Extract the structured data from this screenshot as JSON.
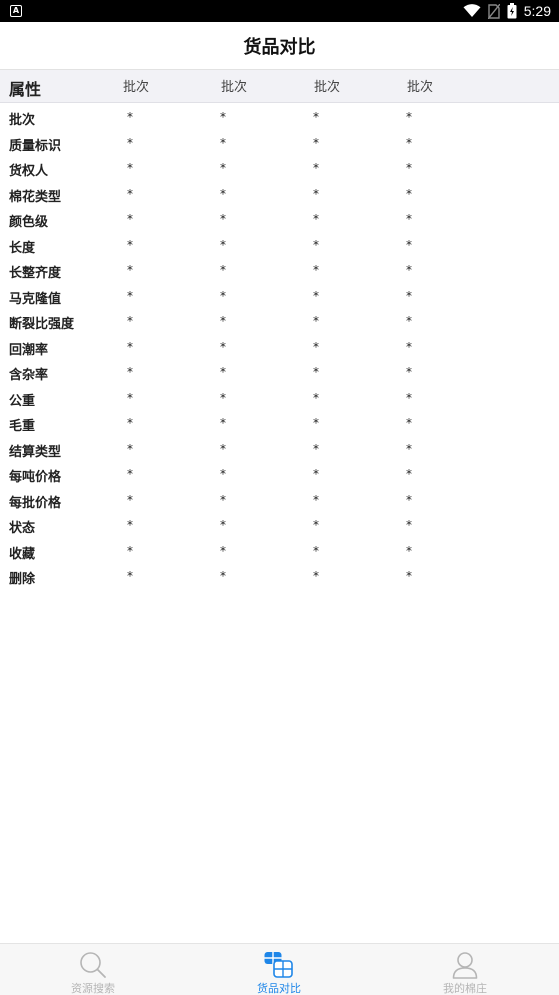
{
  "status_bar": {
    "notification_icon": "A",
    "time": "5:29"
  },
  "title": "货品对比",
  "header": {
    "attribute_label": "属性",
    "columns": [
      "批次",
      "批次",
      "批次",
      "批次"
    ]
  },
  "rows": [
    {
      "label": "批次",
      "values": [
        "*",
        "*",
        "*",
        "*"
      ]
    },
    {
      "label": "质量标识",
      "values": [
        "*",
        "*",
        "*",
        "*"
      ]
    },
    {
      "label": "货权人",
      "values": [
        "*",
        "*",
        "*",
        "*"
      ]
    },
    {
      "label": "棉花类型",
      "values": [
        "*",
        "*",
        "*",
        "*"
      ]
    },
    {
      "label": "颜色级",
      "values": [
        "*",
        "*",
        "*",
        "*"
      ]
    },
    {
      "label": "长度",
      "values": [
        "*",
        "*",
        "*",
        "*"
      ]
    },
    {
      "label": "长整齐度",
      "values": [
        "*",
        "*",
        "*",
        "*"
      ]
    },
    {
      "label": "马克隆值",
      "values": [
        "*",
        "*",
        "*",
        "*"
      ]
    },
    {
      "label": "断裂比强度",
      "values": [
        "*",
        "*",
        "*",
        "*"
      ]
    },
    {
      "label": "回潮率",
      "values": [
        "*",
        "*",
        "*",
        "*"
      ]
    },
    {
      "label": "含杂率",
      "values": [
        "*",
        "*",
        "*",
        "*"
      ]
    },
    {
      "label": "公重",
      "values": [
        "*",
        "*",
        "*",
        "*"
      ]
    },
    {
      "label": "毛重",
      "values": [
        "*",
        "*",
        "*",
        "*"
      ]
    },
    {
      "label": "结算类型",
      "values": [
        "*",
        "*",
        "*",
        "*"
      ]
    },
    {
      "label": "每吨价格",
      "values": [
        "*",
        "*",
        "*",
        "*"
      ]
    },
    {
      "label": "每批价格",
      "values": [
        "*",
        "*",
        "*",
        "*"
      ]
    },
    {
      "label": "状态",
      "values": [
        "*",
        "*",
        "*",
        "*"
      ]
    },
    {
      "label": "收藏",
      "values": [
        "*",
        "*",
        "*",
        "*"
      ]
    },
    {
      "label": "删除",
      "values": [
        "*",
        "*",
        "*",
        "*"
      ]
    }
  ],
  "bottom_nav": {
    "items": [
      {
        "label": "资源搜索",
        "icon": "search-icon",
        "active": false
      },
      {
        "label": "货品对比",
        "icon": "compare-icon",
        "active": true
      },
      {
        "label": "我的棉庄",
        "icon": "user-icon",
        "active": false
      }
    ]
  },
  "colors": {
    "accent": "#1e86e8",
    "inactive": "#b5b5b5",
    "header_bg": "#f2f2f6"
  }
}
